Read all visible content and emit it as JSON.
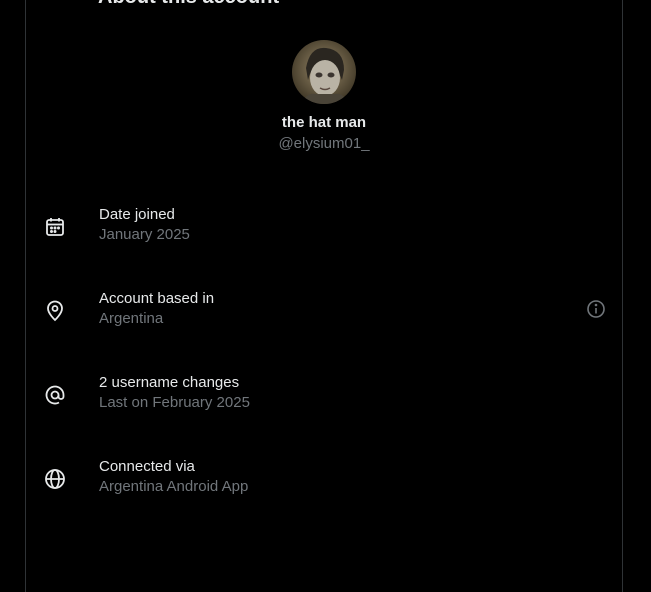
{
  "header": {
    "title": "About this account"
  },
  "profile": {
    "name": "the hat man",
    "handle": "@elysium01_"
  },
  "rows": [
    {
      "icon": "calendar-icon",
      "label": "Date joined",
      "value": "January 2025"
    },
    {
      "icon": "location-pin-icon",
      "label": "Account based in",
      "value": "Argentina",
      "info_icon": "info-icon"
    },
    {
      "icon": "at-sign-icon",
      "label": "2 username changes",
      "value": "Last on February 2025"
    },
    {
      "icon": "globe-icon",
      "label": "Connected via",
      "value": "Argentina Android App"
    }
  ],
  "colors": {
    "background": "#000000",
    "primary_text": "#e7e9ea",
    "secondary_text": "#71767b",
    "border": "#2f3336"
  }
}
